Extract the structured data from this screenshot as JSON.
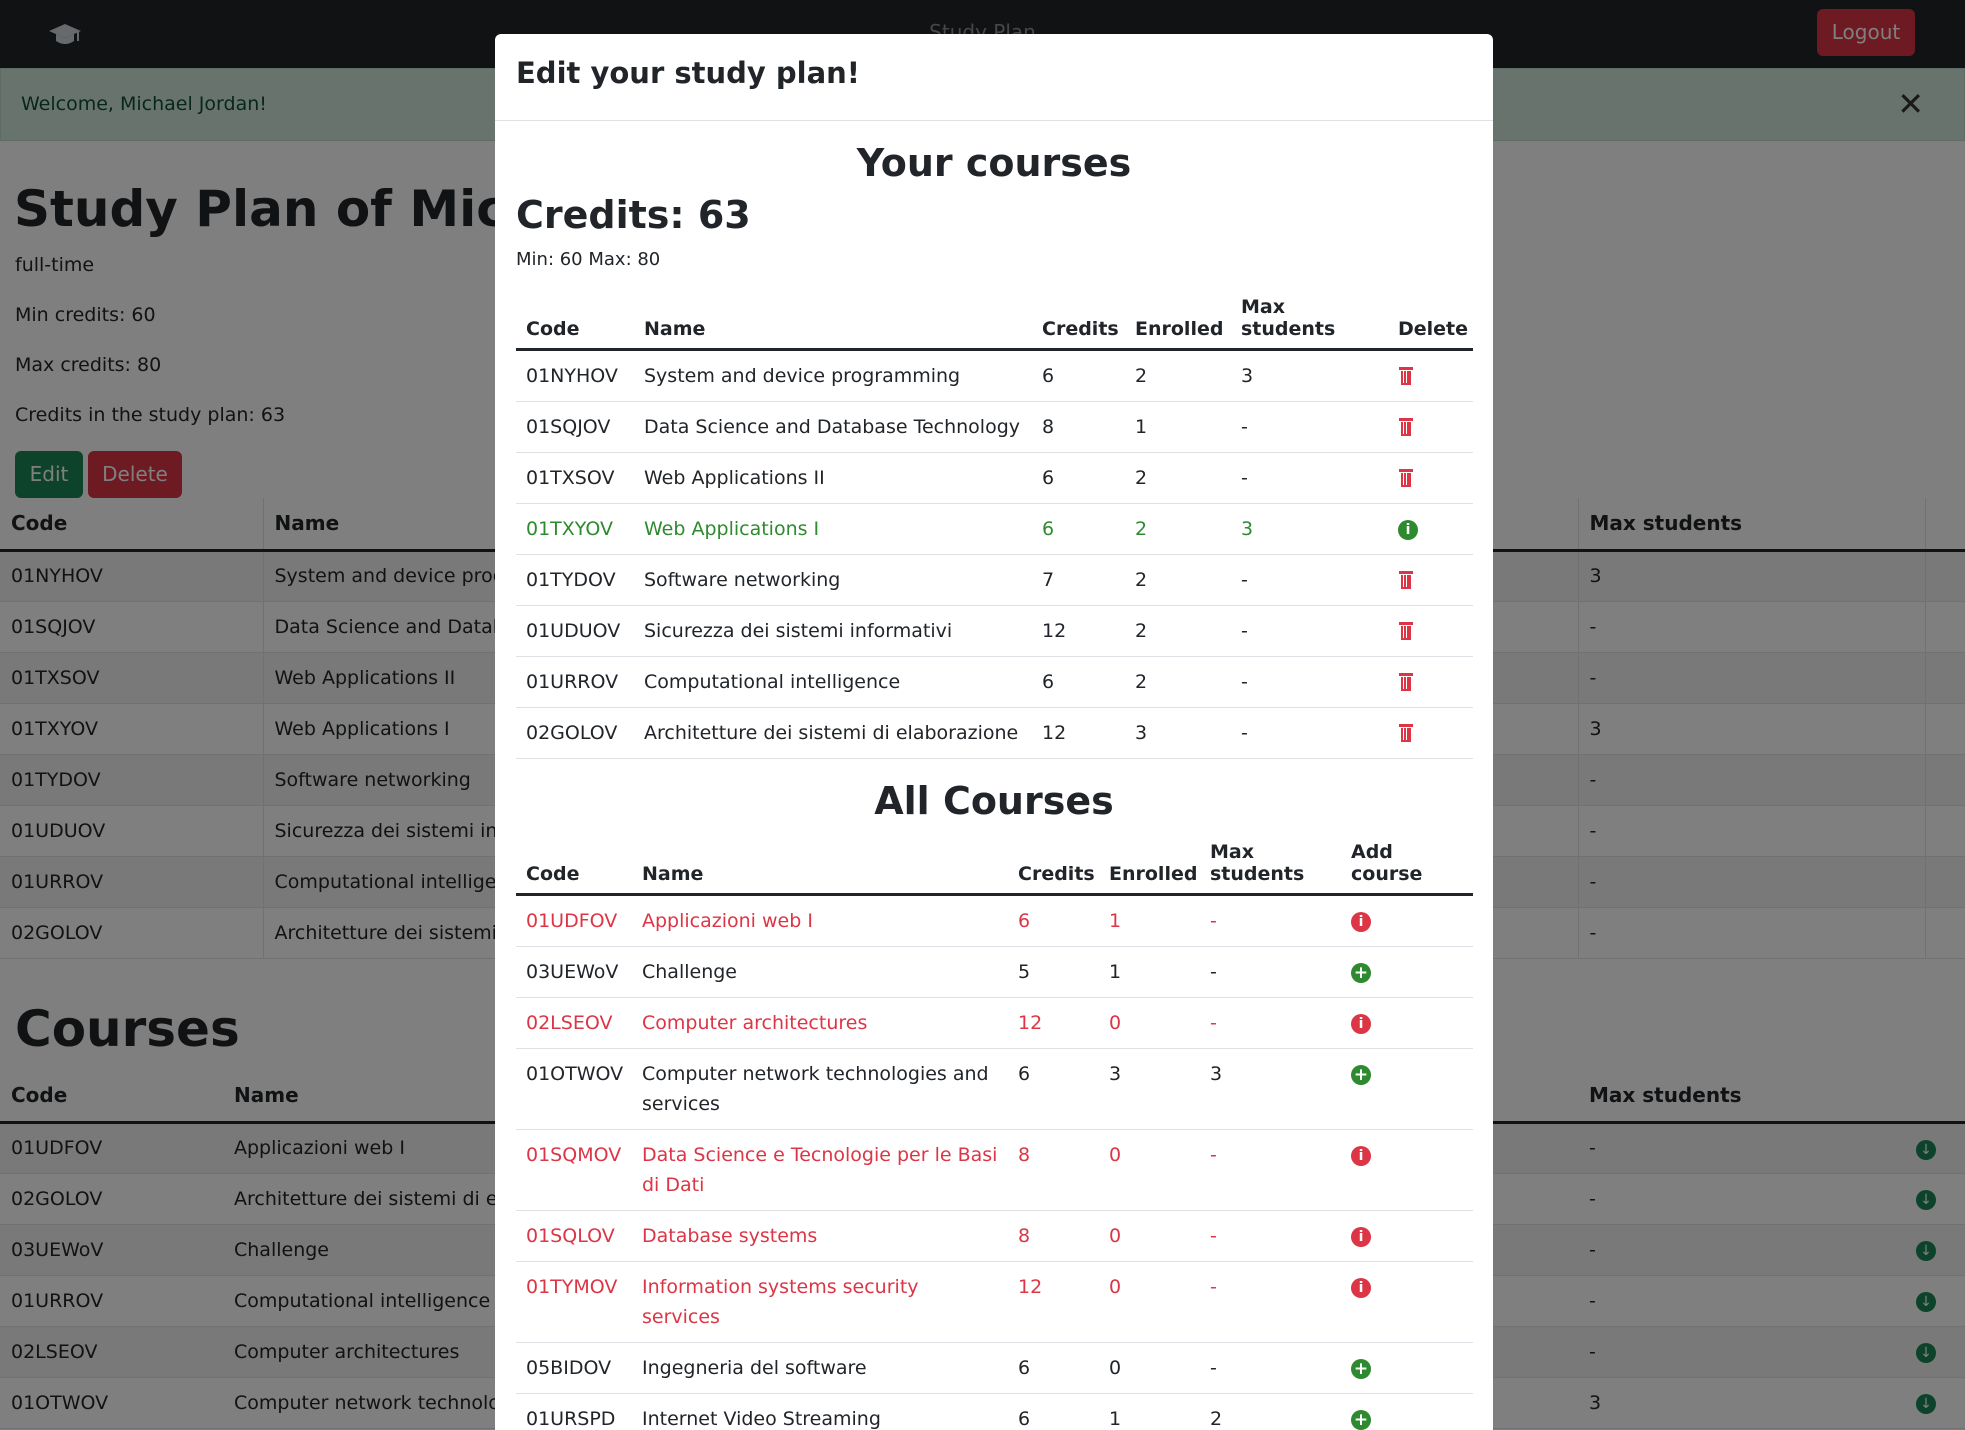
{
  "navbar": {
    "title": "Study Plan",
    "logout_label": "Logout",
    "logo_icon": "graduation-cap-icon"
  },
  "alert": {
    "text": "Welcome, Michael Jordan!",
    "close_glyph": "✕"
  },
  "plan": {
    "title": "Study Plan of Michael Jordan",
    "type": "full-time",
    "min_credits": "Min credits: 60",
    "max_credits": "Max credits: 80",
    "credits_in_plan": "Credits in the study plan: 63",
    "edit_label": "Edit",
    "delete_label": "Delete",
    "table_headers": [
      "Code",
      "Name",
      "",
      "",
      "",
      "Max students",
      ""
    ],
    "rows": [
      {
        "code": "01NYHOV",
        "name": "System and device programming",
        "max": "3"
      },
      {
        "code": "01SQJOV",
        "name": "Data Science and Database Technology",
        "max": "-"
      },
      {
        "code": "01TXSOV",
        "name": "Web Applications II",
        "max": "-"
      },
      {
        "code": "01TXYOV",
        "name": "Web Applications I",
        "max": "3"
      },
      {
        "code": "01TYDOV",
        "name": "Software networking",
        "max": "-"
      },
      {
        "code": "01UDUOV",
        "name": "Sicurezza dei sistemi informativi",
        "max": "-"
      },
      {
        "code": "01URROV",
        "name": "Computational intelligence",
        "max": "-"
      },
      {
        "code": "02GOLOV",
        "name": "Architetture dei sistemi di elaborazione",
        "max": "-"
      }
    ]
  },
  "courses": {
    "title": "Courses",
    "table_headers": [
      "Code",
      "Name",
      "",
      "",
      "",
      "Max students",
      ""
    ],
    "rows": [
      {
        "code": "01UDFOV",
        "name": "Applicazioni web I",
        "max": "-"
      },
      {
        "code": "02GOLOV",
        "name": "Architetture dei sistemi di elaborazione",
        "max": "-"
      },
      {
        "code": "03UEWoV",
        "name": "Challenge",
        "max": "-"
      },
      {
        "code": "01URROV",
        "name": "Computational intelligence",
        "max": "-"
      },
      {
        "code": "02LSEOV",
        "name": "Computer architectures",
        "max": "-"
      },
      {
        "code": "01OTWOV",
        "name": "Computer network technologies and services",
        "max": "3"
      }
    ]
  },
  "modal": {
    "header": "Edit your study plan!",
    "your_courses_title": "Your courses",
    "credits_label": "Credits: 63",
    "minmax": "Min: 60 Max: 80",
    "your_headers": [
      "Code",
      "Name",
      "Credits",
      "Enrolled",
      "Max students",
      "Delete"
    ],
    "your_rows": [
      {
        "code": "01NYHOV",
        "name": "System and device programming",
        "credits": "6",
        "enrolled": "2",
        "max": "3",
        "action": "delete",
        "status": "normal"
      },
      {
        "code": "01SQJOV",
        "name": "Data Science and Database Technology",
        "credits": "8",
        "enrolled": "1",
        "max": "-",
        "action": "delete",
        "status": "normal"
      },
      {
        "code": "01TXSOV",
        "name": "Web Applications II",
        "credits": "6",
        "enrolled": "2",
        "max": "-",
        "action": "delete",
        "status": "normal"
      },
      {
        "code": "01TXYOV",
        "name": "Web Applications I",
        "credits": "6",
        "enrolled": "2",
        "max": "3",
        "action": "info",
        "status": "green"
      },
      {
        "code": "01TYDOV",
        "name": "Software networking",
        "credits": "7",
        "enrolled": "2",
        "max": "-",
        "action": "delete",
        "status": "normal"
      },
      {
        "code": "01UDUOV",
        "name": "Sicurezza dei sistemi informativi",
        "credits": "12",
        "enrolled": "2",
        "max": "-",
        "action": "delete",
        "status": "normal"
      },
      {
        "code": "01URROV",
        "name": "Computational intelligence",
        "credits": "6",
        "enrolled": "2",
        "max": "-",
        "action": "delete",
        "status": "normal"
      },
      {
        "code": "02GOLOV",
        "name": "Architetture dei sistemi di elaborazione",
        "credits": "12",
        "enrolled": "3",
        "max": "-",
        "action": "delete",
        "status": "normal"
      }
    ],
    "all_courses_title": "All Courses",
    "all_headers": [
      "Code",
      "Name",
      "Credits",
      "Enrolled",
      "Max students",
      "Add course"
    ],
    "all_rows": [
      {
        "code": "01UDFOV",
        "name": "Applicazioni web I",
        "credits": "6",
        "enrolled": "1",
        "max": "-",
        "action": "info",
        "status": "red"
      },
      {
        "code": "03UEWoV",
        "name": "Challenge",
        "credits": "5",
        "enrolled": "1",
        "max": "-",
        "action": "add",
        "status": "normal"
      },
      {
        "code": "02LSEOV",
        "name": "Computer architectures",
        "credits": "12",
        "enrolled": "0",
        "max": "-",
        "action": "info",
        "status": "red"
      },
      {
        "code": "01OTWOV",
        "name": "Computer network technologies and services",
        "credits": "6",
        "enrolled": "3",
        "max": "3",
        "action": "add",
        "status": "normal"
      },
      {
        "code": "01SQMOV",
        "name": "Data Science e Tecnologie per le Basi di Dati",
        "credits": "8",
        "enrolled": "0",
        "max": "-",
        "action": "info",
        "status": "red"
      },
      {
        "code": "01SQLOV",
        "name": "Database systems",
        "credits": "8",
        "enrolled": "0",
        "max": "-",
        "action": "info",
        "status": "red"
      },
      {
        "code": "01TYMOV",
        "name": "Information systems security services",
        "credits": "12",
        "enrolled": "0",
        "max": "-",
        "action": "info",
        "status": "red"
      },
      {
        "code": "05BIDOV",
        "name": "Ingegneria del software",
        "credits": "6",
        "enrolled": "0",
        "max": "-",
        "action": "add",
        "status": "normal"
      },
      {
        "code": "01URSPD",
        "name": "Internet Video Streaming",
        "credits": "6",
        "enrolled": "1",
        "max": "2",
        "action": "add",
        "status": "normal"
      }
    ]
  },
  "colors": {
    "danger": "#dc3545",
    "success": "#198754",
    "dark": "#212529",
    "alert_bg": "#d1e7dd"
  }
}
